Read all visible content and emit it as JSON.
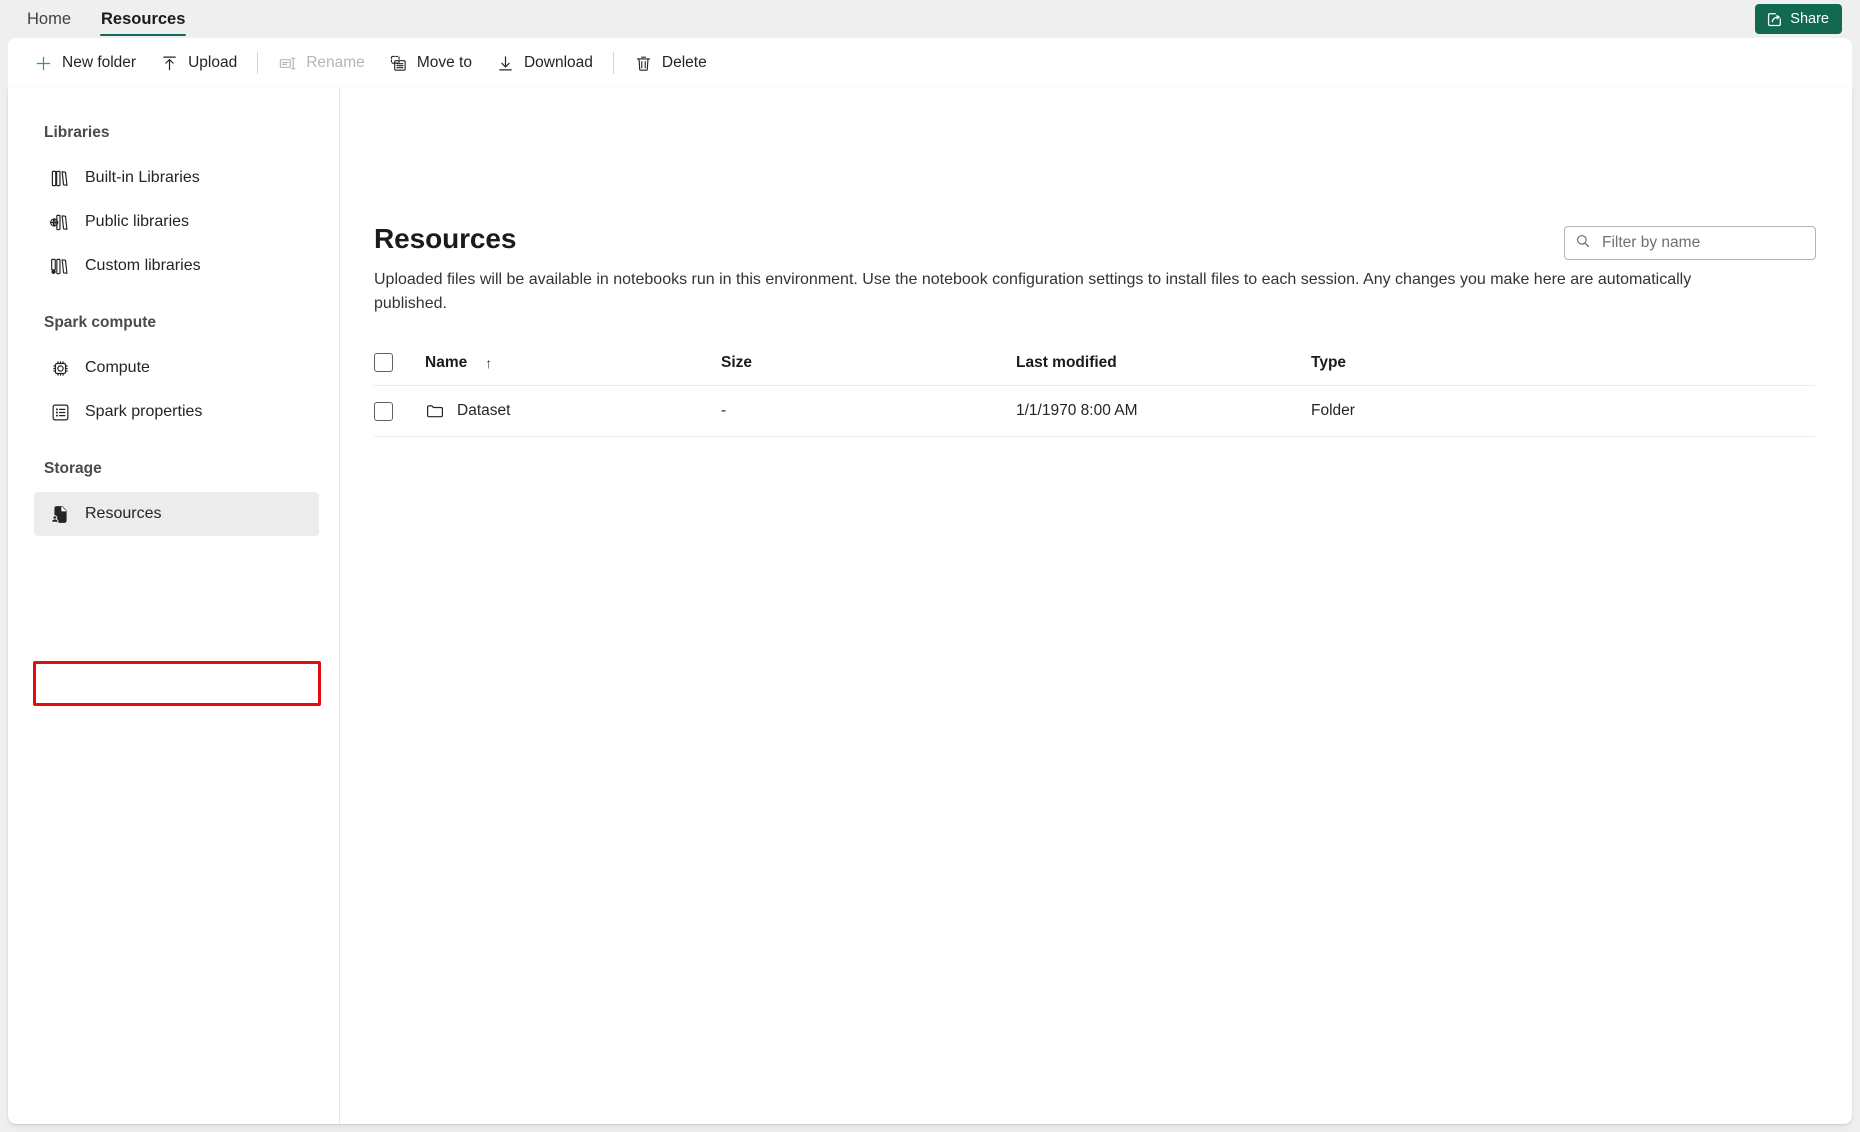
{
  "app": {
    "tabs": [
      {
        "label": "Home",
        "active": false
      },
      {
        "label": "Resources",
        "active": true
      }
    ],
    "share_label": "Share",
    "accent_color": "#11694f",
    "highlight_color": "#e00d0d"
  },
  "toolbar": {
    "new_folder_label": "New folder",
    "upload_label": "Upload",
    "rename_label": "Rename",
    "move_to_label": "Move to",
    "download_label": "Download",
    "delete_label": "Delete"
  },
  "sidebar": {
    "groups": [
      {
        "title": "Libraries",
        "items": [
          {
            "label": "Built-in Libraries",
            "icon": "built-in-libraries-icon",
            "selected": false
          },
          {
            "label": "Public libraries",
            "icon": "public-libraries-icon",
            "selected": false
          },
          {
            "label": "Custom libraries",
            "icon": "custom-libraries-icon",
            "selected": false
          }
        ]
      },
      {
        "title": "Spark compute",
        "items": [
          {
            "label": "Compute",
            "icon": "compute-chip-icon",
            "selected": false
          },
          {
            "label": "Spark properties",
            "icon": "properties-list-icon",
            "selected": false
          }
        ]
      },
      {
        "title": "Storage",
        "items": [
          {
            "label": "Resources",
            "icon": "resources-file-icon",
            "selected": true
          }
        ]
      }
    ]
  },
  "main": {
    "title": "Resources",
    "description": "Uploaded files will be available in notebooks run in this environment. Use the notebook configuration settings to install files to each session. Any changes you make here are automatically published.",
    "filter": {
      "placeholder": "Filter by name",
      "value": ""
    },
    "table": {
      "columns": [
        "Name",
        "Size",
        "Last modified",
        "Type"
      ],
      "sort_column": "Name",
      "sort_direction": "ascending",
      "sort_glyph": "↑",
      "rows": [
        {
          "name": "Dataset",
          "size": "-",
          "last_modified": "1/1/1970 8:00 AM",
          "type": "Folder",
          "icon": "folder-icon",
          "checked": false
        }
      ]
    }
  }
}
